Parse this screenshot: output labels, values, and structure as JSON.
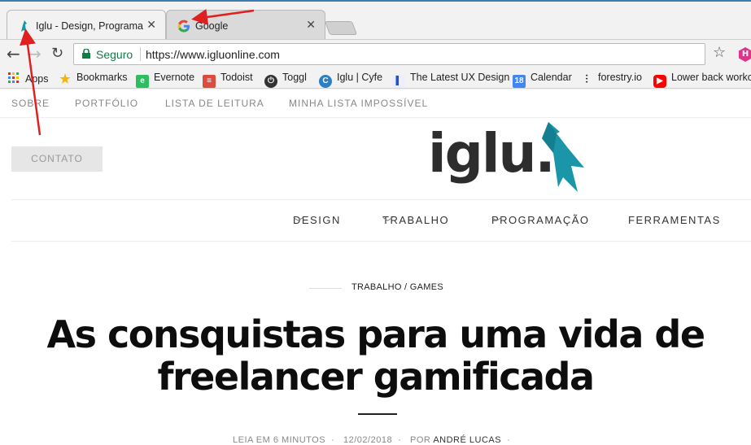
{
  "browser": {
    "tabs": [
      {
        "title": "Iglu - Design, Programaç",
        "active": true
      },
      {
        "title": "Google",
        "active": false
      }
    ],
    "omnibox": {
      "secure_label": "Seguro",
      "url": "https://www.igluonline.com"
    },
    "bookmarks": [
      {
        "label": "Apps"
      },
      {
        "label": "Bookmarks"
      },
      {
        "label": "Evernote"
      },
      {
        "label": "Todoist"
      },
      {
        "label": "Toggl"
      },
      {
        "label": "Iglu | Cyfe"
      },
      {
        "label": "The Latest UX Design"
      },
      {
        "label": "Calendar",
        "badge": "18"
      },
      {
        "label": "forestry.io"
      },
      {
        "label": "Lower back worko"
      }
    ],
    "extension_badge": "H"
  },
  "site": {
    "topnav": [
      "SOBRE",
      "PORTFÓLIO",
      "LISTA DE LEITURA",
      "MINHA LISTA IMPOSSÍVEL"
    ],
    "contact_button": "CONTATO",
    "logo_text": "iglu.",
    "mainnav": [
      "DESIGN",
      "TRABALHO",
      "PROGRAMAÇÃO",
      "FERRAMENTAS"
    ],
    "article": {
      "category": "TRABALHO / GAMES",
      "title_line1": "As consquistas para uma vida de",
      "title_line2": "freelancer gamificada",
      "read_time": "LEIA EM 6 MINUTOS",
      "date": "12/02/2018",
      "by": "POR",
      "author": "ANDRÉ LUCAS"
    }
  },
  "colors": {
    "accent": "#1a96a8",
    "secure": "#0b8043",
    "annotation": "#e02020"
  }
}
